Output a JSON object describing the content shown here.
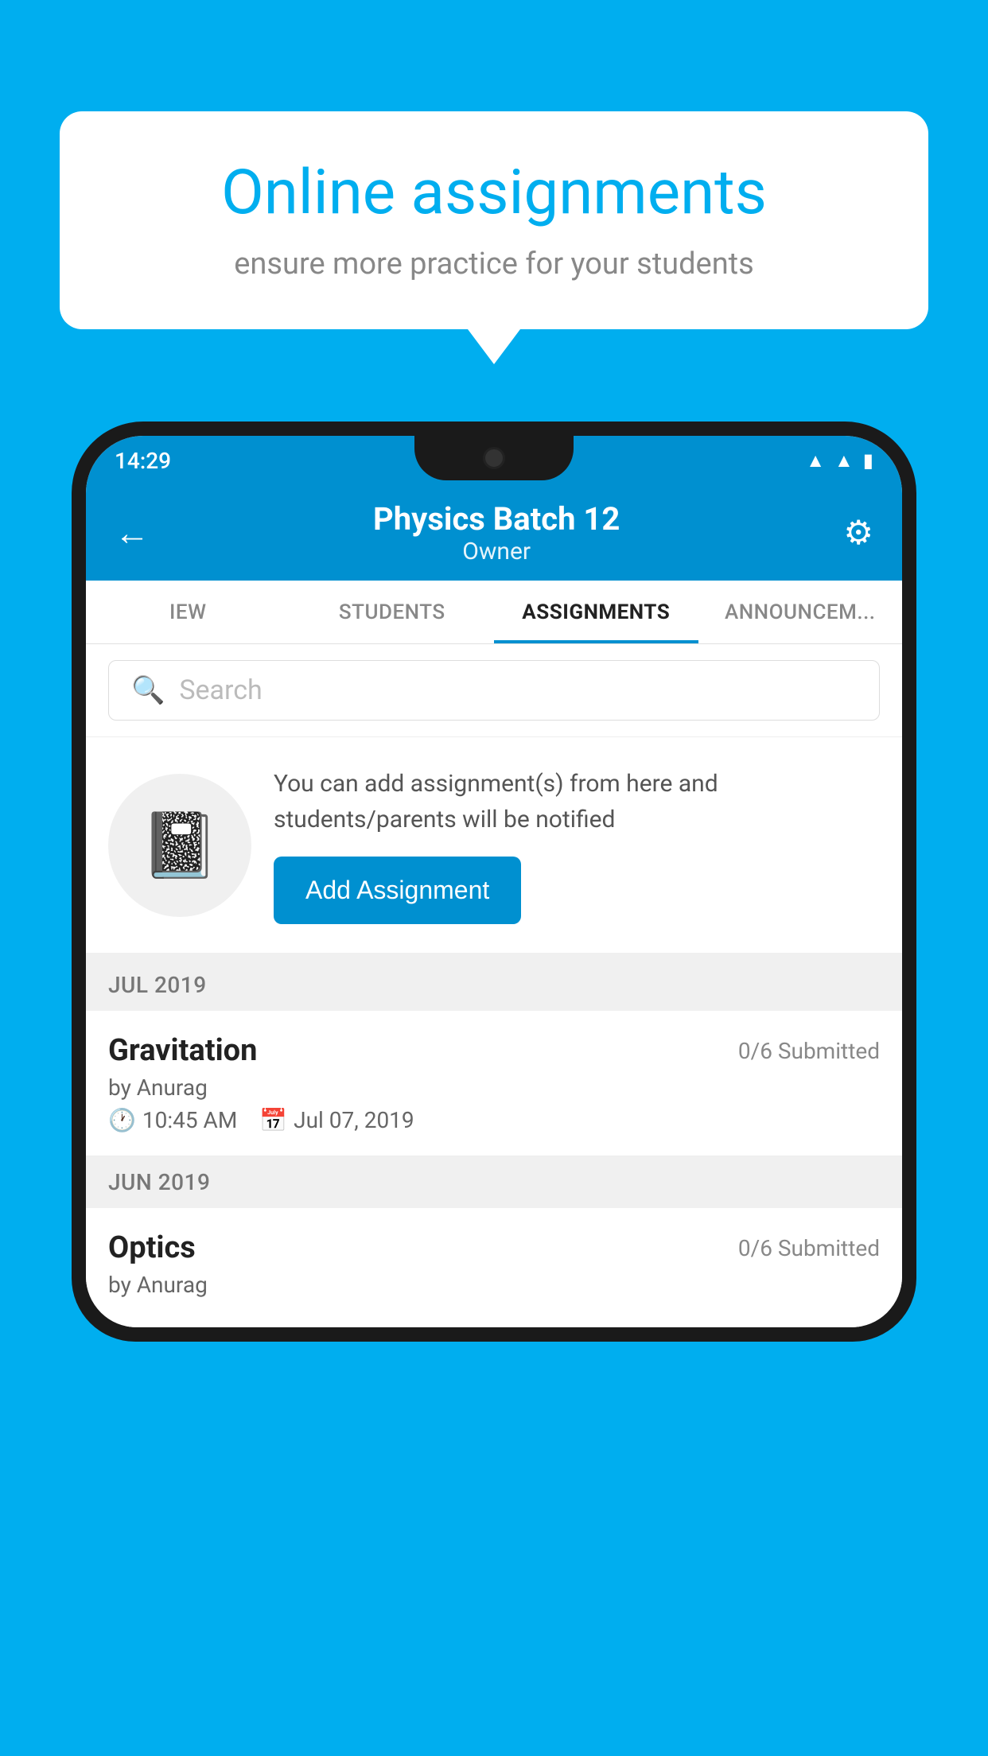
{
  "background_color": "#00AEEF",
  "speech_bubble": {
    "title": "Online assignments",
    "subtitle": "ensure more practice for your students"
  },
  "status_bar": {
    "time": "14:29",
    "wifi": "wifi-icon",
    "signal": "signal-icon",
    "battery": "battery-icon"
  },
  "header": {
    "title": "Physics Batch 12",
    "subtitle": "Owner",
    "back_label": "←",
    "settings_label": "⚙"
  },
  "tabs": [
    {
      "label": "IEW",
      "active": false
    },
    {
      "label": "STUDENTS",
      "active": false
    },
    {
      "label": "ASSIGNMENTS",
      "active": true
    },
    {
      "label": "ANNOUNCEM...",
      "active": false
    }
  ],
  "search": {
    "placeholder": "Search"
  },
  "promo": {
    "description": "You can add assignment(s) from here and students/parents will be notified",
    "button_label": "Add Assignment"
  },
  "sections": [
    {
      "month_label": "JUL 2019",
      "assignments": [
        {
          "title": "Gravitation",
          "submitted": "0/6 Submitted",
          "by": "by Anurag",
          "time": "10:45 AM",
          "date": "Jul 07, 2019"
        }
      ]
    },
    {
      "month_label": "JUN 2019",
      "assignments": [
        {
          "title": "Optics",
          "submitted": "0/6 Submitted",
          "by": "by Anurag",
          "time": "",
          "date": ""
        }
      ]
    }
  ]
}
